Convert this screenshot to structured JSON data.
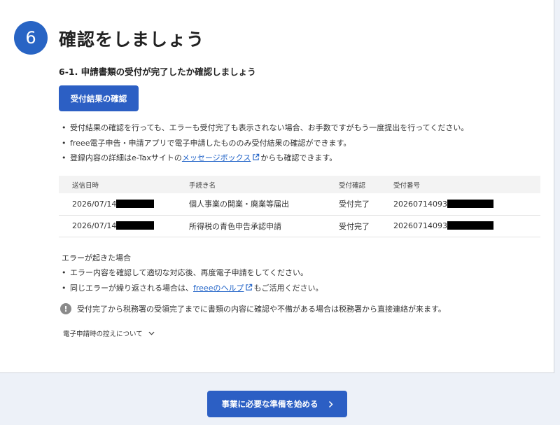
{
  "step": {
    "number": "6",
    "title": "確認をしましょう"
  },
  "section": {
    "subtitle": "6-1. 申請書類の受付が完了したか確認しましょう",
    "confirm_button": "受付結果の確認",
    "bullets": [
      "受付結果の確認を行っても、エラーも受付完了も表示されない場合、お手数ですがもう一度提出を行ってください。",
      "freee電子申告・申請アプリで電子申請したもののみ受付結果の確認ができます。"
    ],
    "bullet3_prefix": "登録内容の詳細はe-Taxサイトの",
    "bullet3_link": "メッセージボックス",
    "bullet3_suffix": "からも確認できます。"
  },
  "table": {
    "headers": [
      "送信日時",
      "手続き名",
      "受付確認",
      "受付番号"
    ],
    "rows": [
      {
        "date": "2026/07/14",
        "procedure": "個人事業の開業・廃業等届出",
        "status": "受付完了",
        "number": "20260714093"
      },
      {
        "date": "2026/07/14",
        "procedure": "所得税の青色申告承認申請",
        "status": "受付完了",
        "number": "20260714093"
      }
    ]
  },
  "errors": {
    "title": "エラーが起きた場合",
    "bullet1": "エラー内容を確認して適切な対応後、再度電子申請をしてください。",
    "bullet2_prefix": "同じエラーが繰り返される場合は、",
    "bullet2_link": "freeeのヘルプ",
    "bullet2_suffix": "もご活用ください。"
  },
  "info": {
    "icon": "!",
    "text": "受付完了から税務署の受領完了までに書類の内容に確認や不備がある場合は税務署から直接連絡が来ます。"
  },
  "collapse": {
    "label": "電子申請時の控えについて"
  },
  "cta": {
    "label": "事業に必要な準備を始める"
  },
  "colors": {
    "primary": "#2c5fc4",
    "link": "#2264c8",
    "success": "#3b8a3a",
    "background": "#edf1f8"
  }
}
